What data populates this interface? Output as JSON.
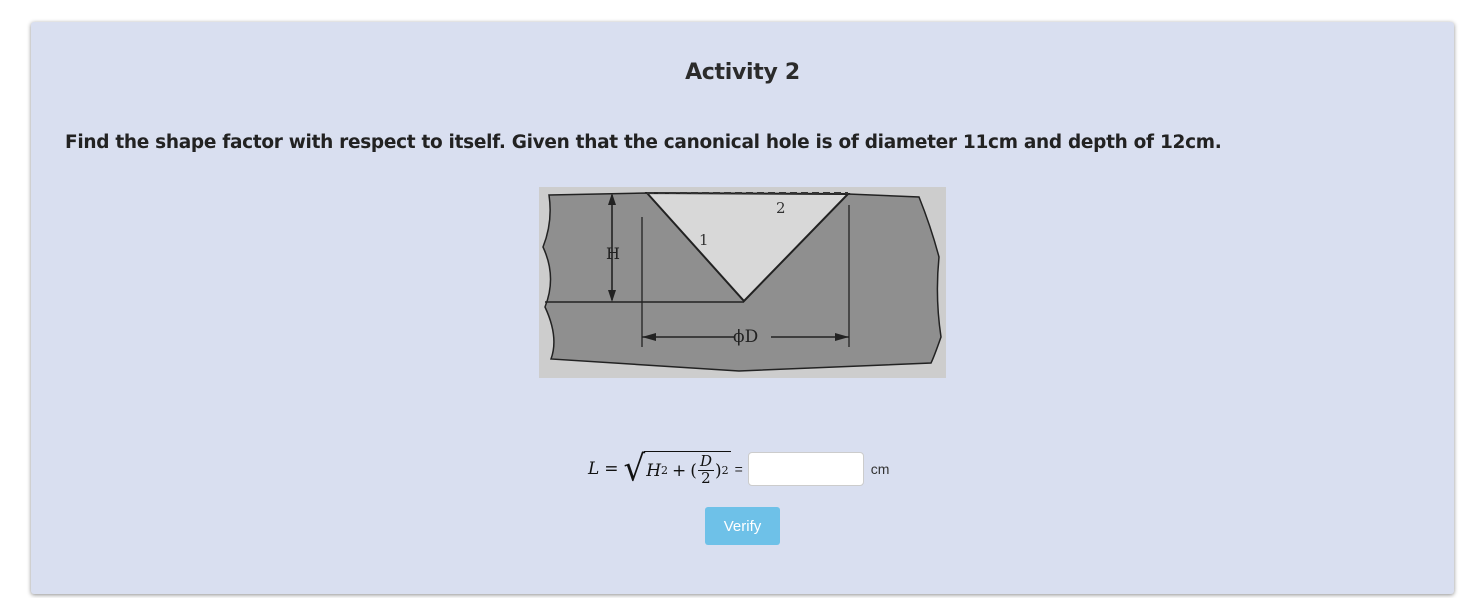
{
  "activity": {
    "title": "Activity 2",
    "question": "Find the shape factor with respect to itself. Given that the canonical hole is of diameter 11cm and depth of 12cm."
  },
  "figure": {
    "label_h": "H",
    "label_d": "ϕD",
    "label_1": "1",
    "label_2": "2"
  },
  "formula": {
    "lhs": "L",
    "equals": "=",
    "h_var": "H",
    "exponent": "2",
    "plus": "+",
    "frac_num": "D",
    "frac_den": "2",
    "trailing_equals": "="
  },
  "answer": {
    "value": "",
    "placeholder": "",
    "unit": "cm"
  },
  "verify_button": {
    "label": "Verify"
  },
  "colors": {
    "card_bg": "#d9dff0",
    "button_bg": "#6ec1e8"
  }
}
